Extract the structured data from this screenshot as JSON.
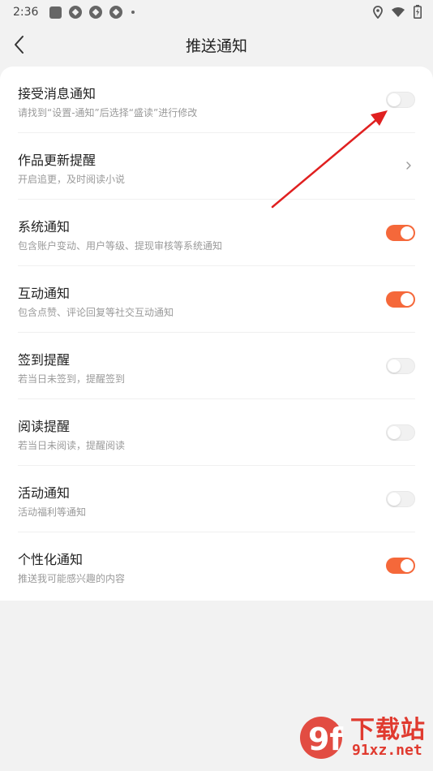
{
  "status_bar": {
    "time": "2:36",
    "icons": [
      "notification-box-icon",
      "aperture-icon",
      "aperture-icon",
      "aperture-icon",
      "dot-icon"
    ],
    "right_icons": [
      "location-icon",
      "wifi-icon",
      "battery-icon"
    ]
  },
  "header": {
    "title": "推送通知",
    "back_icon": "chevron-left-icon"
  },
  "settings": [
    {
      "title": "接受消息通知",
      "subtitle": "请找到“设置-通知”后选择“盛读”进行修改",
      "control": "toggle",
      "on": false
    },
    {
      "title": "作品更新提醒",
      "subtitle": "开启追更，及时阅读小说",
      "control": "chevron",
      "on": null
    },
    {
      "title": "系统通知",
      "subtitle": "包含账户变动、用户等级、提现审核等系统通知",
      "control": "toggle",
      "on": true
    },
    {
      "title": "互动通知",
      "subtitle": "包含点赞、评论回复等社交互动通知",
      "control": "toggle",
      "on": true
    },
    {
      "title": "签到提醒",
      "subtitle": "若当日未签到，提醒签到",
      "control": "toggle",
      "on": false
    },
    {
      "title": "阅读提醒",
      "subtitle": "若当日未阅读，提醒阅读",
      "control": "toggle",
      "on": false
    },
    {
      "title": "活动通知",
      "subtitle": "活动福利等通知",
      "control": "toggle",
      "on": false
    },
    {
      "title": "个性化通知",
      "subtitle": "推送我可能感兴趣的内容",
      "control": "toggle",
      "on": true
    }
  ],
  "colors": {
    "accent": "#f5683a",
    "annotation_arrow": "#e02020",
    "watermark": "#e03a2f"
  },
  "watermark": {
    "logo_text": "9f",
    "line1": "下载站",
    "line2": "91xz.net"
  }
}
